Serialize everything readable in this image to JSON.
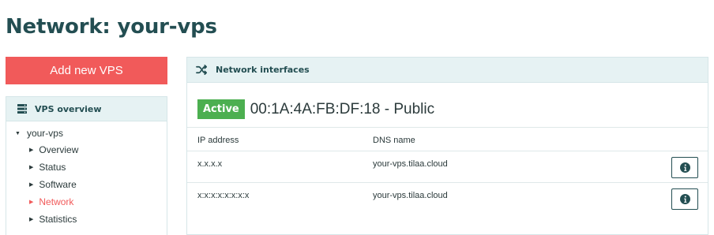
{
  "page": {
    "title": "Network: your-vps"
  },
  "sidebar": {
    "add_button_label": "Add new VPS",
    "panel_title": "VPS overview",
    "tree": {
      "root_label": "your-vps",
      "items": [
        {
          "label": "Overview",
          "active": false
        },
        {
          "label": "Status",
          "active": false
        },
        {
          "label": "Software",
          "active": false
        },
        {
          "label": "Network",
          "active": true
        },
        {
          "label": "Statistics",
          "active": false
        }
      ]
    }
  },
  "main": {
    "panel_title": "Network interfaces",
    "interface": {
      "status_badge": "Active",
      "title": "00:1A:4A:FB:DF:18 - Public"
    },
    "table": {
      "columns": [
        "IP address",
        "DNS name"
      ],
      "rows": [
        {
          "ip": "x.x.x.x",
          "dns": "your-vps.tilaa.cloud"
        },
        {
          "ip": "x:x:x:x:x:x:x:x",
          "dns": "your-vps.tilaa.cloud"
        }
      ]
    }
  },
  "colors": {
    "accent_red": "#f15a5a",
    "heading_teal": "#234e52",
    "panel_header_bg": "#e6f2f3",
    "badge_green": "#4caf50"
  },
  "icons": {
    "sidebar_header": "server-stack-icon",
    "main_header": "shuffle-icon",
    "row_action": "info-icon",
    "tree_expanded": "triangle-down-icon",
    "tree_item": "triangle-right-icon"
  }
}
